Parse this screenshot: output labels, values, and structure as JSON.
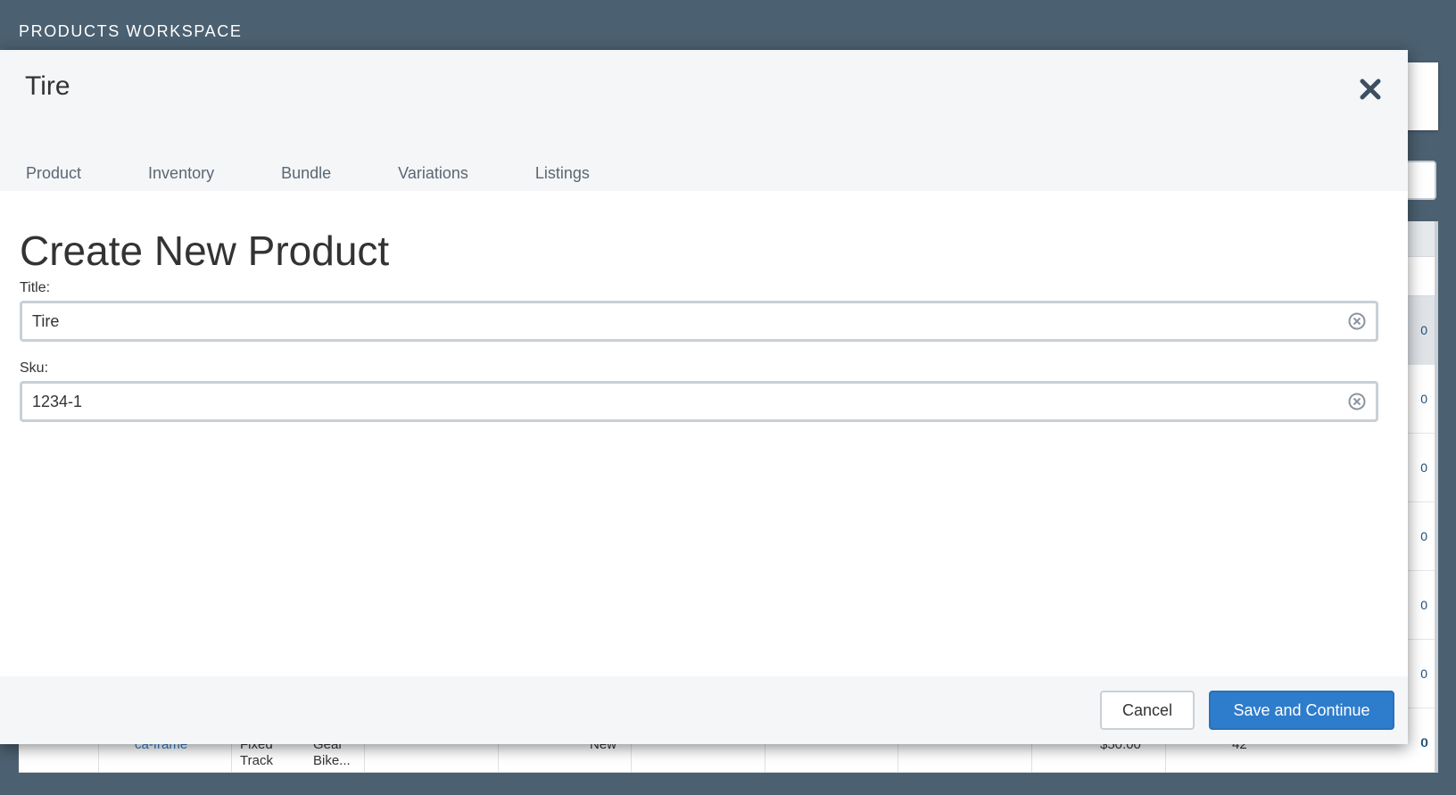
{
  "workspace": {
    "title": "PRODUCTS WORKSPACE"
  },
  "background": {
    "row_values": [
      "0",
      "0",
      "0",
      "0",
      "0",
      "0",
      "0"
    ],
    "last_row_texts": [
      "ca-frame",
      "Fixed",
      "Track",
      "Gear",
      "Bike...",
      "New",
      "$50.00",
      "42"
    ],
    "final_row_value": "0"
  },
  "modal": {
    "title": "Tire",
    "tabs": [
      "Product",
      "Inventory",
      "Bundle",
      "Variations",
      "Listings"
    ],
    "heading": "Create New Product",
    "fields": {
      "title": {
        "label": "Title:",
        "value": "Tire"
      },
      "sku": {
        "label": "Sku:",
        "value": "1234-1"
      }
    },
    "buttons": {
      "cancel": "Cancel",
      "save": "Save and Continue"
    }
  },
  "colors": {
    "header_bg": "#4b6070",
    "primary": "#2e7ccc"
  },
  "icons": {
    "close": "close-icon",
    "clear": "clear-icon"
  }
}
